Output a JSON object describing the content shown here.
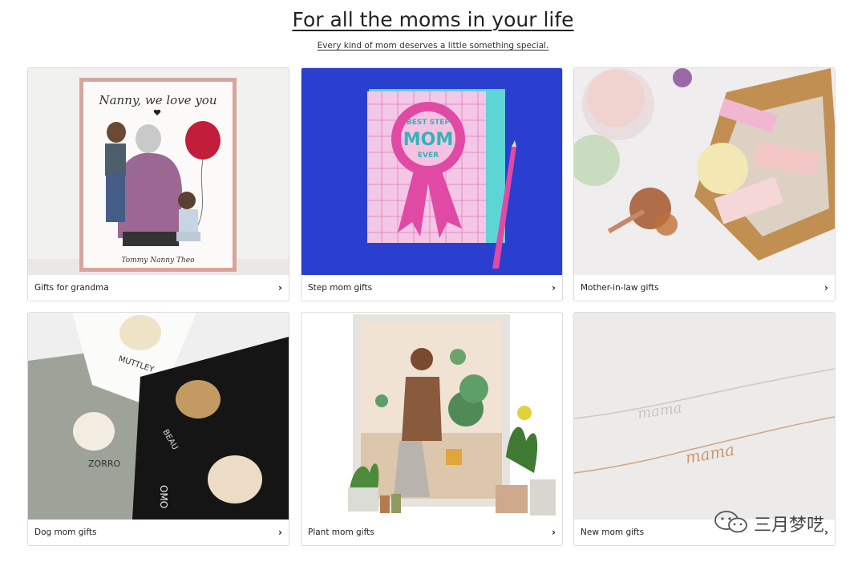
{
  "header": {
    "title": "For all the moms in your life",
    "subtitle": "Every kind of mom deserves a little something special."
  },
  "cards": [
    {
      "label": "Gifts for grandma",
      "image_text": [
        "Nanny, we love you",
        "Tommy  Nanny  Theo"
      ]
    },
    {
      "label": "Step mom gifts",
      "image_text": [
        "BEST STEP",
        "MOM",
        "EVER"
      ]
    },
    {
      "label": "Mother-in-law gifts"
    },
    {
      "label": "Dog mom gifts",
      "image_text": [
        "MUTTLEY",
        "ZORRO",
        "BEAU",
        "OMO"
      ]
    },
    {
      "label": "Plant mom gifts"
    },
    {
      "label": "New mom gifts",
      "image_text": [
        "mama",
        "mama"
      ]
    }
  ],
  "watermark": {
    "text": "三月梦呓",
    "icon": "wechat-icon"
  },
  "icons": {
    "chevron": "chevron-right-icon"
  }
}
